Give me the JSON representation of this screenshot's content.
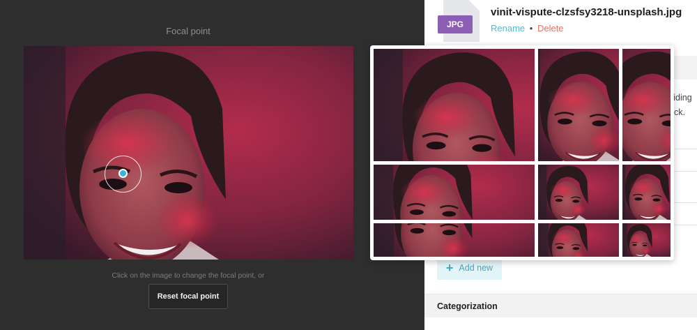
{
  "focal": {
    "title": "Focal point",
    "hint": "Click on the image to change the focal point, or",
    "reset_label": "Reset focal point"
  },
  "file": {
    "type_badge": "JPG",
    "name": "vinit-vispute-clzsfsy3218-unsplash.jpg",
    "rename_label": "Rename",
    "separator": "•",
    "delete_label": "Delete"
  },
  "description_fragment": {
    "line1": "viding",
    "line2": "ack."
  },
  "buttons": {
    "add_new_label": "Add new"
  },
  "sections": {
    "categorization": "Categorization"
  },
  "colors": {
    "focal_dot": "#3ab4d6",
    "link": "#5bb8cf",
    "delete": "#e4735e",
    "badge": "#8c5fb4",
    "add_new_bg": "#e3f4f8",
    "add_new_text": "#3fa9c4"
  },
  "icons": {
    "plus": "+",
    "file": "file-jpg-icon"
  }
}
